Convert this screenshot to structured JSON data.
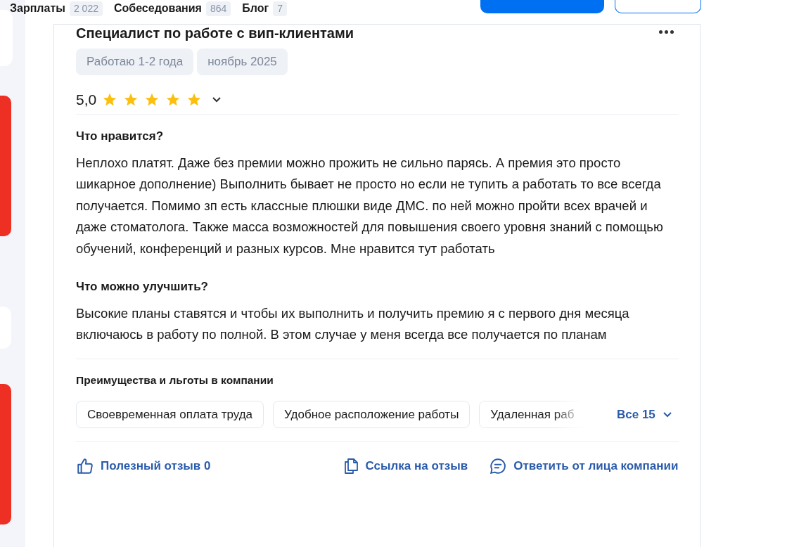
{
  "top_nav": [
    {
      "label": "Зарплаты",
      "count": "2 022"
    },
    {
      "label": "Собеседования",
      "count": "864"
    },
    {
      "label": "Блог",
      "count": "7"
    }
  ],
  "review": {
    "title": "Специалист по работе с вип-клиентами",
    "tags": [
      "Работаю 1-2 года",
      "ноябрь 2025"
    ],
    "rating": "5,0",
    "stars": 5,
    "sections": [
      {
        "heading": "Что нравится?",
        "text": "Неплохо платят. Даже без премии можно прожить не сильно парясь. А премия это просто шикарное дополнение) Выполнить бывает не просто но если не тупить а работать то все всегда получается. Помимо зп есть классные плюшки виде ДМС. по ней можно пройти всех врачей и даже стоматолога. Также масса возможностей для повышения своего уровня знаний с помощью обучений, конференций и разных курсов. Мне нравится тут работать"
      },
      {
        "heading": "Что можно улучшить?",
        "text": "Высокие планы ставятся и чтобы их выполнить и получить премию я с первого дня месяца включаюсь в работу по полной. В этом случае у меня всегда все получается по планам"
      }
    ],
    "benefits_title": "Преимущества и льготы в компании",
    "benefits": [
      "Своевременная оплата труда",
      "Удобное расположение работы",
      "Удаленная раб"
    ],
    "benefits_more": "Все 15",
    "actions": [
      {
        "kind": "like",
        "label": "Полезный отзыв 0"
      },
      {
        "kind": "link",
        "label": "Ссылка на отзыв"
      },
      {
        "kind": "reply",
        "label": "Ответить от лица компании"
      }
    ]
  }
}
